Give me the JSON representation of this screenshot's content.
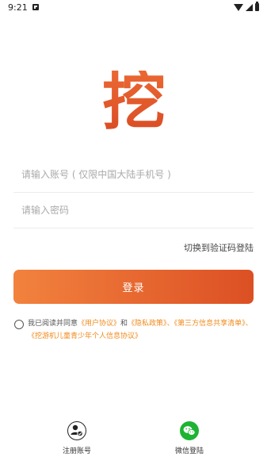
{
  "status_bar": {
    "time": "9:21"
  },
  "logo": {
    "text": "挖",
    "color": "#e0522a"
  },
  "account_field": {
    "placeholder": "请输入账号 ( 仅限中国大陆手机号 )",
    "value": ""
  },
  "password_field": {
    "placeholder": "请输入密码",
    "value": ""
  },
  "switch_link": "切换到验证码登陆",
  "login_button": "登录",
  "agreement": {
    "prefix": "我已阅读并同意",
    "user_agreement": "《用户协议》",
    "and": "和",
    "privacy_policy": "《隐私政策》",
    "sep1": "、",
    "third_party": "《第三方信息共享清单》",
    "sep2": "、",
    "child_policy": "《挖游机儿童青少年个人信息协议》",
    "checked": false
  },
  "bottom": {
    "register_label": "注册账号",
    "wechat_label": "微信登陆"
  },
  "colors": {
    "accent_start": "#f2823e",
    "accent_end": "#dc5024",
    "link": "#f08a1c",
    "wechat": "#1db333"
  }
}
